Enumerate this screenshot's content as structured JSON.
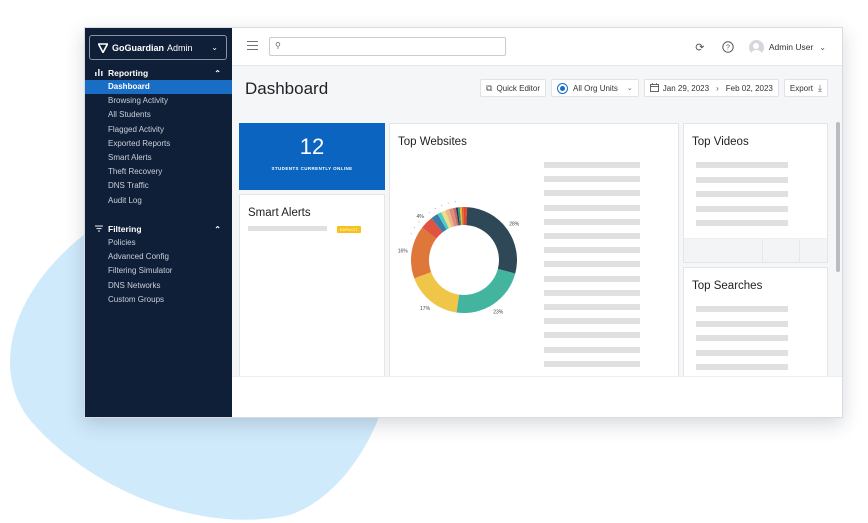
{
  "colors": {
    "sidebar_bg": "#0f1f38",
    "accent": "#1a6dc5",
    "stat_card_bg": "#0b64c0",
    "badge_yellow": "#f6c21b",
    "blob": "#cfeafb"
  },
  "sidebar": {
    "brand_name": "GoGuardian",
    "brand_sub": "Admin",
    "brand_icon": "shield-logo-icon",
    "sections": [
      {
        "label": "Reporting",
        "icon": "bar-chart-icon",
        "expanded": true,
        "items": [
          {
            "label": "Dashboard",
            "active": true
          },
          {
            "label": "Browsing Activity"
          },
          {
            "label": "All Students"
          },
          {
            "label": "Flagged Activity"
          },
          {
            "label": "Exported Reports"
          },
          {
            "label": "Smart Alerts"
          },
          {
            "label": "Theft Recovery"
          },
          {
            "label": "DNS Traffic"
          },
          {
            "label": "Audit Log"
          }
        ]
      },
      {
        "label": "Filtering",
        "icon": "filter-icon",
        "expanded": true,
        "items": [
          {
            "label": "Policies"
          },
          {
            "label": "Advanced Config"
          },
          {
            "label": "Filtering Simulator"
          },
          {
            "label": "DNS Networks"
          },
          {
            "label": "Custom Groups"
          }
        ]
      }
    ]
  },
  "topbar": {
    "search_placeholder": "",
    "user_name": "Admin User"
  },
  "page": {
    "title": "Dashboard"
  },
  "toolbar": {
    "quick_editor": "Quick Editor",
    "org_units": "All Org Units",
    "date_start": "Jan 29, 2023",
    "date_end": "Feb 02, 2023",
    "export": "Export"
  },
  "stat": {
    "value": "12",
    "label": "STUDENTS CURRENTLY ONLINE"
  },
  "smart_alerts": {
    "title": "Smart Alerts",
    "badge": "EXPLICIT"
  },
  "top_websites": {
    "title": "Top Websites",
    "placeholder_rows": 15
  },
  "top_videos": {
    "title": "Top Videos",
    "placeholder_rows": 5
  },
  "top_searches": {
    "title": "Top Searches",
    "placeholder_rows": 5
  },
  "chart_data": {
    "type": "pie",
    "variant": "donut",
    "title": "Top Websites",
    "slices": [
      {
        "label": "28%",
        "value": 28,
        "color": "#2f4858"
      },
      {
        "label": "23%",
        "value": 23,
        "color": "#43b59e"
      },
      {
        "label": "17%",
        "value": 17,
        "color": "#f0c649"
      },
      {
        "label": "16%",
        "value": 16,
        "color": "#e0773a"
      },
      {
        "label": "4%",
        "value": 4,
        "color": "#df5340"
      },
      {
        "label": "",
        "value": 2.2,
        "color": "#3f7aa6"
      },
      {
        "label": "",
        "value": 1.2,
        "color": "#49d0c4"
      },
      {
        "label": "",
        "value": 1.3,
        "color": "#f3dc87"
      },
      {
        "label": "",
        "value": 1.2,
        "color": "#e8b88c"
      },
      {
        "label": "",
        "value": 1.3,
        "color": "#e08c7a"
      },
      {
        "label": "",
        "value": 0.8,
        "color": "#c96a6a"
      },
      {
        "label": "",
        "value": 0.6,
        "color": "#2d3a56"
      },
      {
        "label": "",
        "value": 0.6,
        "color": "#1f9e8c"
      },
      {
        "label": "",
        "value": 0.6,
        "color": "#f1b824"
      },
      {
        "label": "",
        "value": 0.6,
        "color": "#e05a2a"
      },
      {
        "label": "",
        "value": 1.0,
        "color": "#e6452f"
      }
    ]
  }
}
